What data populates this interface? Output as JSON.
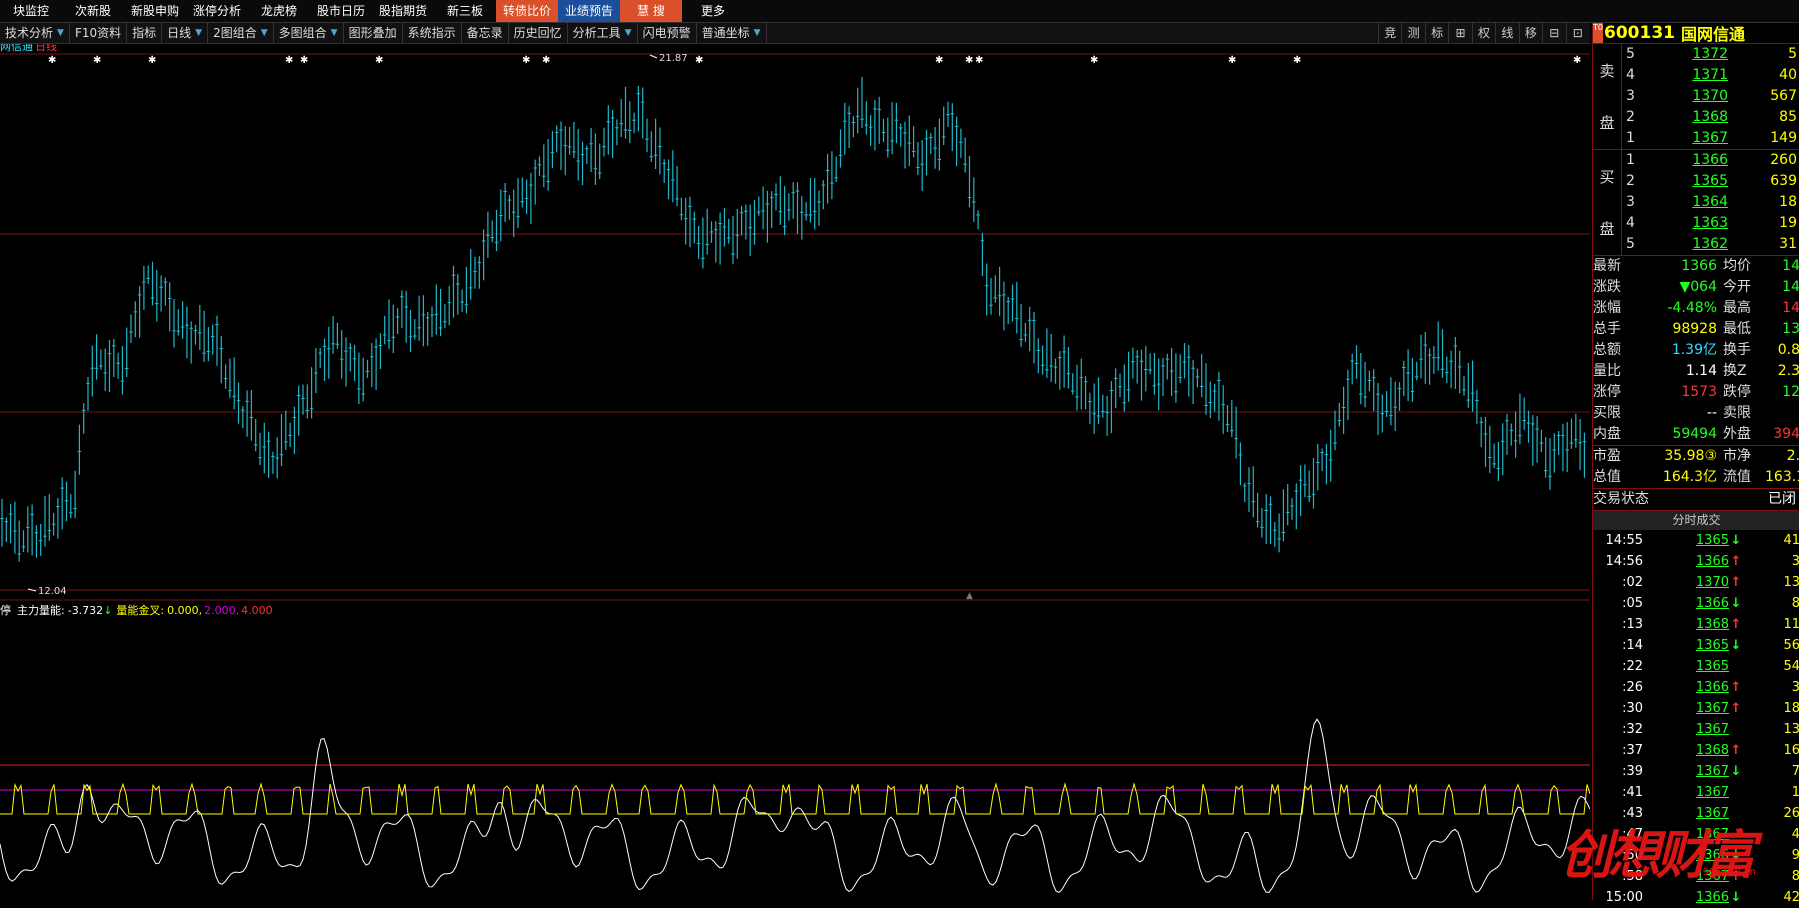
{
  "topnav": [
    "块监控",
    "次新股",
    "新股申购",
    "涨停分析",
    "龙虎榜",
    "股市日历",
    "股指期货",
    "新三板",
    "转债比价",
    "业绩预告",
    "慧 搜",
    "更多"
  ],
  "toolbar": [
    {
      "label": "技术分析",
      "arrow": true
    },
    {
      "label": "F10资料",
      "arrow": false
    },
    {
      "label": "指标",
      "arrow": false
    },
    {
      "label": "日线",
      "arrow": true
    },
    {
      "label": "2图组合",
      "arrow": true
    },
    {
      "label": "多图组合",
      "arrow": true
    },
    {
      "label": "图形叠加",
      "arrow": false
    },
    {
      "label": "系统指示",
      "arrow": false
    },
    {
      "label": "备忘录",
      "arrow": false
    },
    {
      "label": "历史回忆",
      "arrow": false
    },
    {
      "label": "分析工具",
      "arrow": true
    },
    {
      "label": "闪电预警",
      "arrow": false
    },
    {
      "label": "普通坐标",
      "arrow": true
    }
  ],
  "right_tools": [
    "竞",
    "测",
    "标",
    "⊞",
    "权",
    "线",
    "移",
    "⊟",
    "⊡"
  ],
  "main_chart": {
    "title_name": "网信通",
    "title_period": "日线",
    "high_label": "21.87",
    "low_label": "12.04"
  },
  "indicator": {
    "prefix": "停",
    "name": "主力量能:",
    "value": "-3.732",
    "arrow": "↓",
    "cross_name": "量能金叉:",
    "v1": "0.000,",
    "v2": "2.000,",
    "v3": "4.000"
  },
  "stock": {
    "badge": "T0",
    "code": "600131",
    "name": "国网信通"
  },
  "order_book": {
    "sell_label": [
      "卖",
      "盘"
    ],
    "buy_label": [
      "买",
      "盘"
    ],
    "sell": [
      {
        "level": "5",
        "price": "1372",
        "vol": "5"
      },
      {
        "level": "4",
        "price": "1371",
        "vol": "40"
      },
      {
        "level": "3",
        "price": "1370",
        "vol": "567"
      },
      {
        "level": "2",
        "price": "1368",
        "vol": "85"
      },
      {
        "level": "1",
        "price": "1367",
        "vol": "149"
      }
    ],
    "buy": [
      {
        "level": "1",
        "price": "1366",
        "vol": "260"
      },
      {
        "level": "2",
        "price": "1365",
        "vol": "639"
      },
      {
        "level": "3",
        "price": "1364",
        "vol": "18"
      },
      {
        "level": "4",
        "price": "1363",
        "vol": "19"
      },
      {
        "level": "5",
        "price": "1362",
        "vol": "31"
      }
    ]
  },
  "quote_a": [
    {
      "l": "最新",
      "v": "1366",
      "vc": "c-green",
      "l2": "均价",
      "v2": "14",
      "v2c": "c-green"
    },
    {
      "l": "涨跌",
      "v": "▼064",
      "vc": "c-green",
      "l2": "今开",
      "v2": "14",
      "v2c": "c-green"
    },
    {
      "l": "涨幅",
      "v": "-4.48%",
      "vc": "c-green",
      "l2": "最高",
      "v2": "14",
      "v2c": "c-red"
    },
    {
      "l": "总手",
      "v": "98928",
      "vc": "c-yellow",
      "l2": "最低",
      "v2": "13",
      "v2c": "c-green"
    },
    {
      "l": "总额",
      "v": "1.39亿",
      "vc": "c-cyan",
      "l2": "换手",
      "v2": "0.8",
      "v2c": "c-yellow"
    },
    {
      "l": "量比",
      "v": "1.14",
      "vc": "c-white",
      "l2": "换Z",
      "v2": "2.3",
      "v2c": "c-yellow"
    },
    {
      "l": "涨停",
      "v": "1573",
      "vc": "c-red",
      "l2": "跌停",
      "v2": "12",
      "v2c": "c-green"
    },
    {
      "l": "买限",
      "v": "--",
      "vc": "c-white",
      "l2": "卖限",
      "v2": "",
      "v2c": "c-white"
    },
    {
      "l": "内盘",
      "v": "59494",
      "vc": "c-green",
      "l2": "外盘",
      "v2": "394",
      "v2c": "c-red"
    }
  ],
  "quote_b": [
    {
      "l": "市盈",
      "v": "35.98③",
      "vc": "c-yellow",
      "l2": "市净",
      "v2": "2.",
      "v2c": "c-yellow"
    },
    {
      "l": "总值",
      "v": "164.3亿",
      "vc": "c-yellow",
      "l2": "流值",
      "v2": "163.1",
      "v2c": "c-yellow"
    }
  ],
  "trade_status": {
    "label": "交易状态",
    "value": "已闭"
  },
  "ticks_header": "分时成交",
  "ticks": [
    {
      "t": "14:55",
      "p": "1365",
      "d": "down",
      "v": "41"
    },
    {
      "t": "14:56",
      "p": "1366",
      "d": "up",
      "v": "3"
    },
    {
      "t": ":02",
      "p": "1370",
      "d": "up",
      "v": "13"
    },
    {
      "t": ":05",
      "p": "1366",
      "d": "down",
      "v": "8"
    },
    {
      "t": ":13",
      "p": "1368",
      "d": "up",
      "v": "11"
    },
    {
      "t": ":14",
      "p": "1365",
      "d": "down",
      "v": "56"
    },
    {
      "t": ":22",
      "p": "1365",
      "d": "",
      "v": "54"
    },
    {
      "t": ":26",
      "p": "1366",
      "d": "up",
      "v": "3"
    },
    {
      "t": ":30",
      "p": "1367",
      "d": "up",
      "v": "18"
    },
    {
      "t": ":32",
      "p": "1367",
      "d": "",
      "v": "13"
    },
    {
      "t": ":37",
      "p": "1368",
      "d": "up",
      "v": "16"
    },
    {
      "t": ":39",
      "p": "1367",
      "d": "down",
      "v": "7"
    },
    {
      "t": ":41",
      "p": "1367",
      "d": "",
      "v": "1"
    },
    {
      "t": ":43",
      "p": "1367",
      "d": "",
      "v": "26"
    },
    {
      "t": ":47",
      "p": "1367",
      "d": "",
      "v": "4"
    },
    {
      "t": ":50",
      "p": "1366",
      "d": "down",
      "v": "9"
    },
    {
      "t": ":58",
      "p": "1367",
      "d": "up",
      "v": "8"
    },
    {
      "t": "15:00",
      "p": "1366",
      "d": "down",
      "v": "42"
    }
  ],
  "watermark": {
    "title": "创想财富",
    "url": "995168.cn"
  }
}
